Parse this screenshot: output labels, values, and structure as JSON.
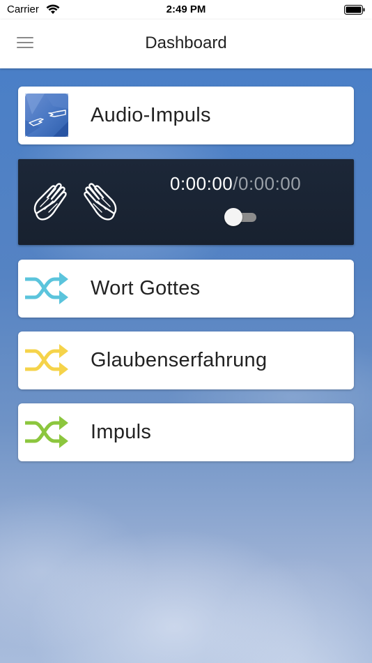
{
  "status_bar": {
    "carrier": "Carrier",
    "time": "2:49 PM"
  },
  "header": {
    "title": "Dashboard",
    "menu_icon": "hamburger-menu-icon"
  },
  "cards": [
    {
      "label": "Audio-Impuls",
      "icon": "creation-hands-image-icon"
    },
    {
      "label": "Wort Gottes",
      "icon": "shuffle-icon",
      "icon_color": "#5bc4dc"
    },
    {
      "label": "Glaubenserfahrung",
      "icon": "shuffle-icon",
      "icon_color": "#f5d34a"
    },
    {
      "label": "Impuls",
      "icon": "shuffle-icon",
      "icon_color": "#8cc63e"
    }
  ],
  "player": {
    "icon": "praying-hands-icon",
    "elapsed": "0:00:00",
    "separator": "/",
    "total": "0:00:00",
    "toggle_on": false
  },
  "colors": {
    "player_background": "#1b2535",
    "card_background": "#ffffff"
  }
}
